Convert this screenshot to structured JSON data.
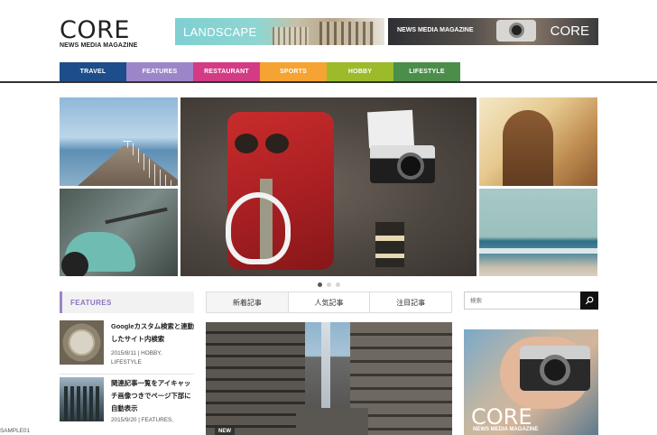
{
  "header": {
    "logo_name": "CORE",
    "logo_tagline": "NEWS MEDIA MAGAZINE",
    "banner_landscape": "LANDSCAPE",
    "banner_core_label": "NEWS MEDIA MAGAZINE",
    "banner_core_name": "CORE"
  },
  "nav": {
    "items": [
      {
        "label": "TRAVEL",
        "color": "#1d4d8a"
      },
      {
        "label": "FEATURES",
        "color": "#9c86c9"
      },
      {
        "label": "RESTAURANT",
        "color": "#d43b85"
      },
      {
        "label": "SPORTS",
        "color": "#f5a332"
      },
      {
        "label": "HOBBY",
        "color": "#9bbb2b"
      },
      {
        "label": "LIFESTYLE",
        "color": "#4b8e4a"
      }
    ]
  },
  "slider": {
    "dot_count": 3,
    "active_index": 0
  },
  "features": {
    "heading": "FEATURES",
    "posts": [
      {
        "title": "Googleカスタム検索と連動したサイト内検索",
        "date": "2015/8/11",
        "categories": "HOBBY,",
        "categories_cont": "LIFESTYLE"
      },
      {
        "title": "関連記事一覧をアイキャッチ画像つきでページ下部に自動表示",
        "date": "2015/9/20",
        "categories": "FEATURES,",
        "categories_cont": "SAMPLE01"
      }
    ]
  },
  "tabs": {
    "items": [
      "新着記事",
      "人気記事",
      "注目記事"
    ],
    "active_index": 0,
    "badge": "NEW"
  },
  "search": {
    "placeholder": "検索"
  },
  "ad": {
    "name": "CORE",
    "tagline": "NEWS MEDIA MAGAZINE"
  },
  "colors": {
    "accent": "#9c86c9",
    "nav_underline": "#333333"
  }
}
